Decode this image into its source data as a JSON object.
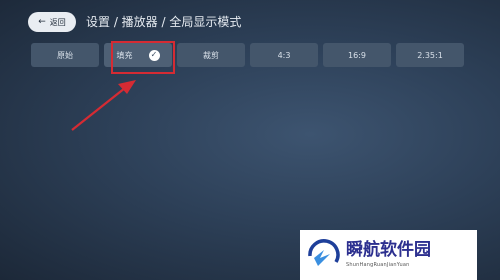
{
  "header": {
    "back_label": "返回",
    "breadcrumb": "设置 / 播放器 / 全局显示模式"
  },
  "options": [
    {
      "label": "原始",
      "selected": false
    },
    {
      "label": "填充",
      "selected": true
    },
    {
      "label": "裁剪",
      "selected": false
    },
    {
      "label": "4:3",
      "selected": false
    },
    {
      "label": "16:9",
      "selected": false
    },
    {
      "label": "2.35:1",
      "selected": false
    }
  ],
  "annotation": {
    "color": "#d52b33"
  },
  "watermark": {
    "title": "瞬航软件园",
    "subtitle": "ShunHangRuanJianYuan"
  }
}
